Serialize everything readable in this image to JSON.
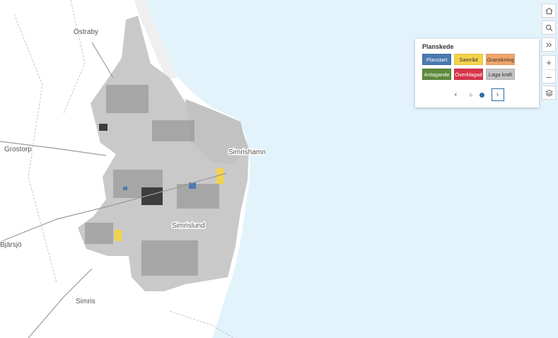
{
  "map": {
    "places": [
      {
        "name": "Östraby"
      },
      {
        "name": "Grostorp"
      },
      {
        "name": "Simrishamn"
      },
      {
        "name": "Simrislund"
      },
      {
        "name": "Bjärsjö"
      },
      {
        "name": "Simris"
      }
    ],
    "colors": {
      "water": "#e3f3fc",
      "land": "#ffffff",
      "urban": "#c9c9c9",
      "buildings": "#8a8a8a"
    }
  },
  "toolbar": {
    "home": {
      "icon": "home-icon"
    },
    "search": {
      "icon": "search-icon"
    },
    "expand": {
      "icon": "double-chevron-right-icon"
    },
    "zoom_in": {
      "label": "+"
    },
    "zoom_out": {
      "label": "–"
    },
    "layers": {
      "icon": "layers-icon"
    }
  },
  "legend": {
    "title": "Planskede",
    "items": [
      {
        "label": "Planstart",
        "color": "#4a79b0",
        "text_color": "#ffffff"
      },
      {
        "label": "Samråd",
        "color": "#f3d34a",
        "text_color": "#333333"
      },
      {
        "label": "Granskning",
        "color": "#f0a56a",
        "text_color": "#333333"
      },
      {
        "label": "Antagande",
        "color": "#5e8a3c",
        "text_color": "#ffffff"
      },
      {
        "label": "Överklagad",
        "color": "#d8344a",
        "text_color": "#ffffff"
      },
      {
        "label": "Laga kraft",
        "color": "#c4c4c4",
        "text_color": "#333333"
      }
    ],
    "pager": {
      "prev": "‹",
      "next": "›",
      "pages": 2,
      "current": 2
    }
  }
}
